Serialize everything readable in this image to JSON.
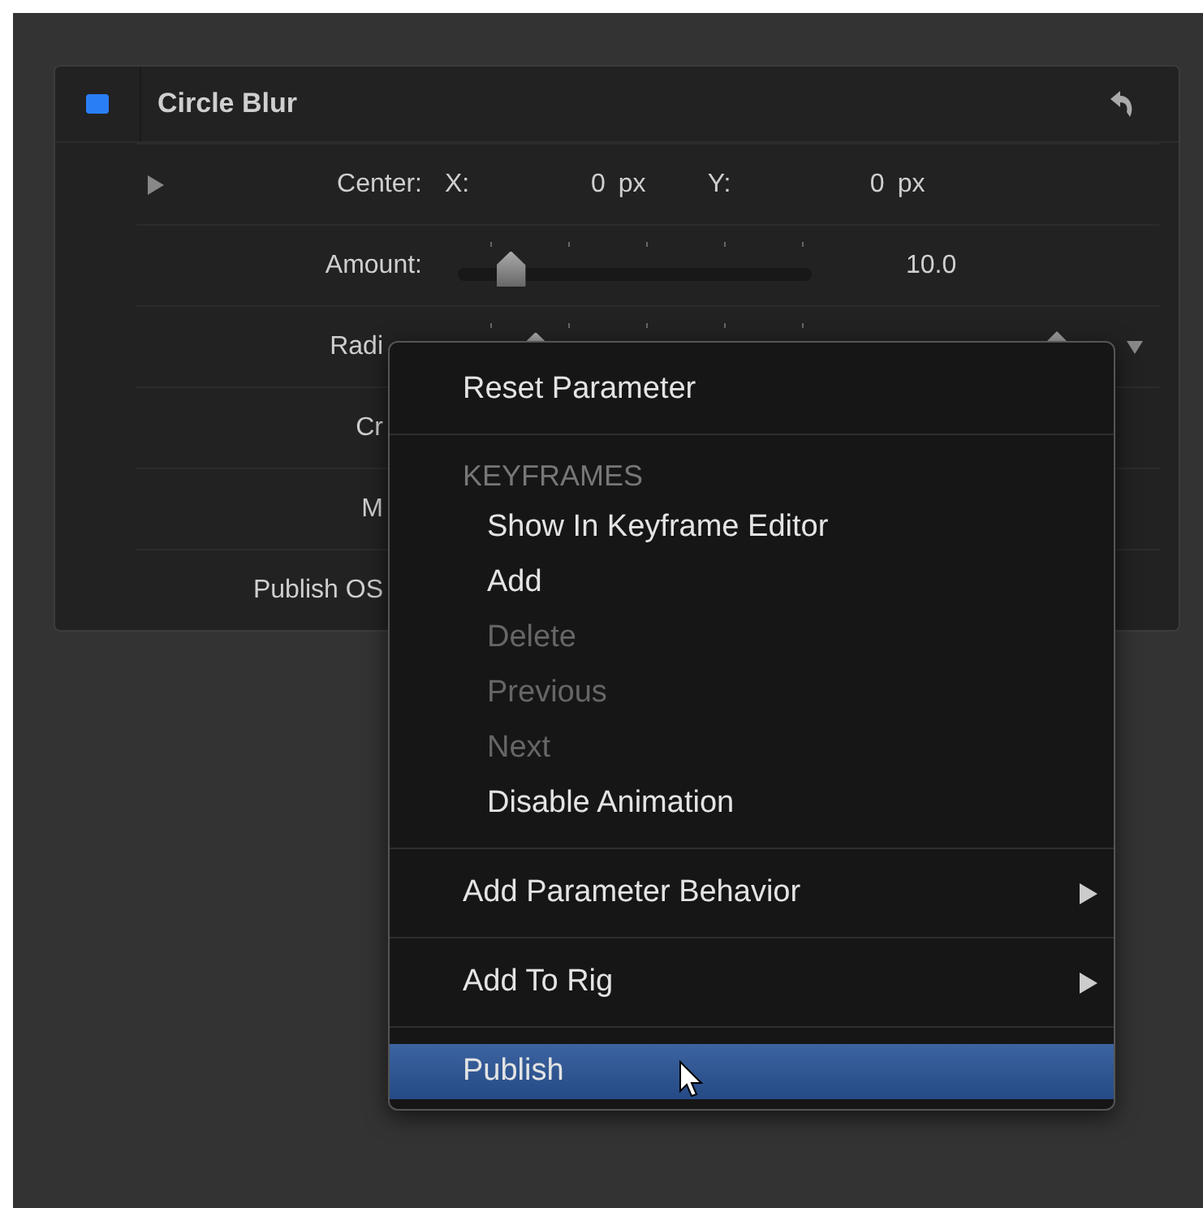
{
  "panel": {
    "title": "Circle Blur",
    "enabled": true,
    "rows": [
      {
        "kind": "point",
        "label": "Center:",
        "expanded": false,
        "x_label": "X:",
        "x_value": "0",
        "x_unit": "px",
        "y_label": "Y:",
        "y_value": "0",
        "y_unit": "px"
      },
      {
        "kind": "slider",
        "label": "Amount:",
        "level": 0.15,
        "value": "10.0"
      },
      {
        "kind": "slider",
        "label": "Radi",
        "level": 0.22,
        "keyframe": true,
        "covered": true
      },
      {
        "kind": "plain",
        "label": "Cr",
        "covered": true
      },
      {
        "kind": "plain",
        "label": "M",
        "covered": true
      },
      {
        "kind": "plain",
        "label": "Publish OS",
        "covered": true
      }
    ]
  },
  "context_menu": {
    "items": [
      {
        "kind": "item",
        "label": "Reset Parameter",
        "indented": false,
        "disabled": false,
        "submenu": false,
        "selected": false
      },
      {
        "kind": "separator"
      },
      {
        "kind": "header",
        "label": "KEYFRAMES"
      },
      {
        "kind": "item",
        "label": "Show In Keyframe Editor",
        "indented": true,
        "disabled": false,
        "submenu": false,
        "selected": false
      },
      {
        "kind": "item",
        "label": "Add",
        "indented": true,
        "disabled": false,
        "submenu": false,
        "selected": false
      },
      {
        "kind": "item",
        "label": "Delete",
        "indented": true,
        "disabled": true,
        "submenu": false,
        "selected": false
      },
      {
        "kind": "item",
        "label": "Previous",
        "indented": true,
        "disabled": true,
        "submenu": false,
        "selected": false
      },
      {
        "kind": "item",
        "label": "Next",
        "indented": true,
        "disabled": true,
        "submenu": false,
        "selected": false
      },
      {
        "kind": "item",
        "label": "Disable Animation",
        "indented": true,
        "disabled": false,
        "submenu": false,
        "selected": false
      },
      {
        "kind": "separator"
      },
      {
        "kind": "item",
        "label": "Add Parameter Behavior",
        "indented": false,
        "disabled": false,
        "submenu": true,
        "selected": false
      },
      {
        "kind": "separator"
      },
      {
        "kind": "item",
        "label": "Add To Rig",
        "indented": false,
        "disabled": false,
        "submenu": true,
        "selected": false
      },
      {
        "kind": "separator"
      },
      {
        "kind": "item",
        "label": "Publish",
        "indented": false,
        "disabled": false,
        "submenu": false,
        "selected": true
      }
    ]
  }
}
